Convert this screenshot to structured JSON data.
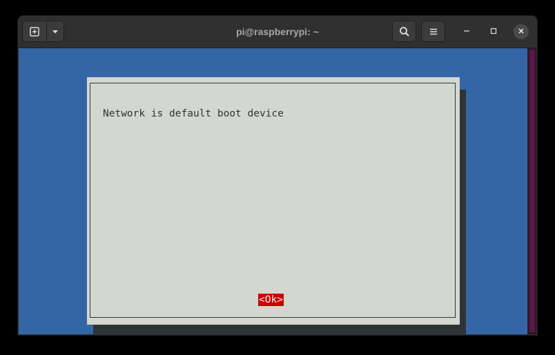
{
  "window": {
    "title": "pi@raspberrypi: ~"
  },
  "toolbar": {
    "new_tab_icon": "new-tab-icon",
    "new_tab_menu_icon": "chevron-down-icon",
    "search_icon": "search-icon",
    "menu_icon": "hamburger-menu-icon",
    "minimize_icon": "minimize-icon",
    "maximize_icon": "maximize-icon",
    "close_icon": "close-icon"
  },
  "dialog": {
    "message": "Network is default boot device",
    "ok_label": "<Ok>"
  },
  "colors": {
    "terminal_background": "#3466a6",
    "dialog_background": "#d3d7cf",
    "dialog_shadow": "#2e3436",
    "button_highlight": "#cc0000",
    "titlebar": "#303030",
    "scrollbar": "#5a1848"
  }
}
